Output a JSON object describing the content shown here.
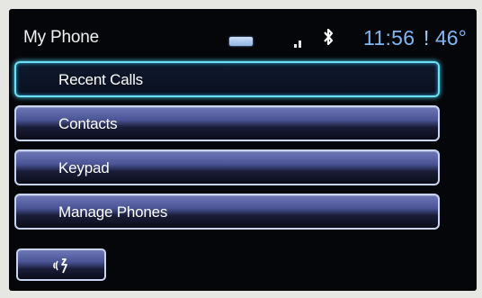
{
  "header": {
    "title": "My Phone",
    "time": "11:56",
    "separator": "!",
    "temperature": "46°"
  },
  "status_icons": [
    "battery-icon",
    "signal-icon",
    "bluetooth-icon"
  ],
  "menu": {
    "items": [
      {
        "label": "Recent Calls",
        "selected": true
      },
      {
        "label": "Contacts",
        "selected": false
      },
      {
        "label": "Keypad",
        "selected": false
      },
      {
        "label": "Manage Phones",
        "selected": false
      }
    ]
  },
  "voice_button": {
    "icon": "voice-recognition-icon"
  },
  "colors": {
    "screen_bg": "#05060a",
    "clock_blue": "#7fb7f2",
    "selection_cyan": "#6ee0f5",
    "button_blue": "#4a5496"
  }
}
